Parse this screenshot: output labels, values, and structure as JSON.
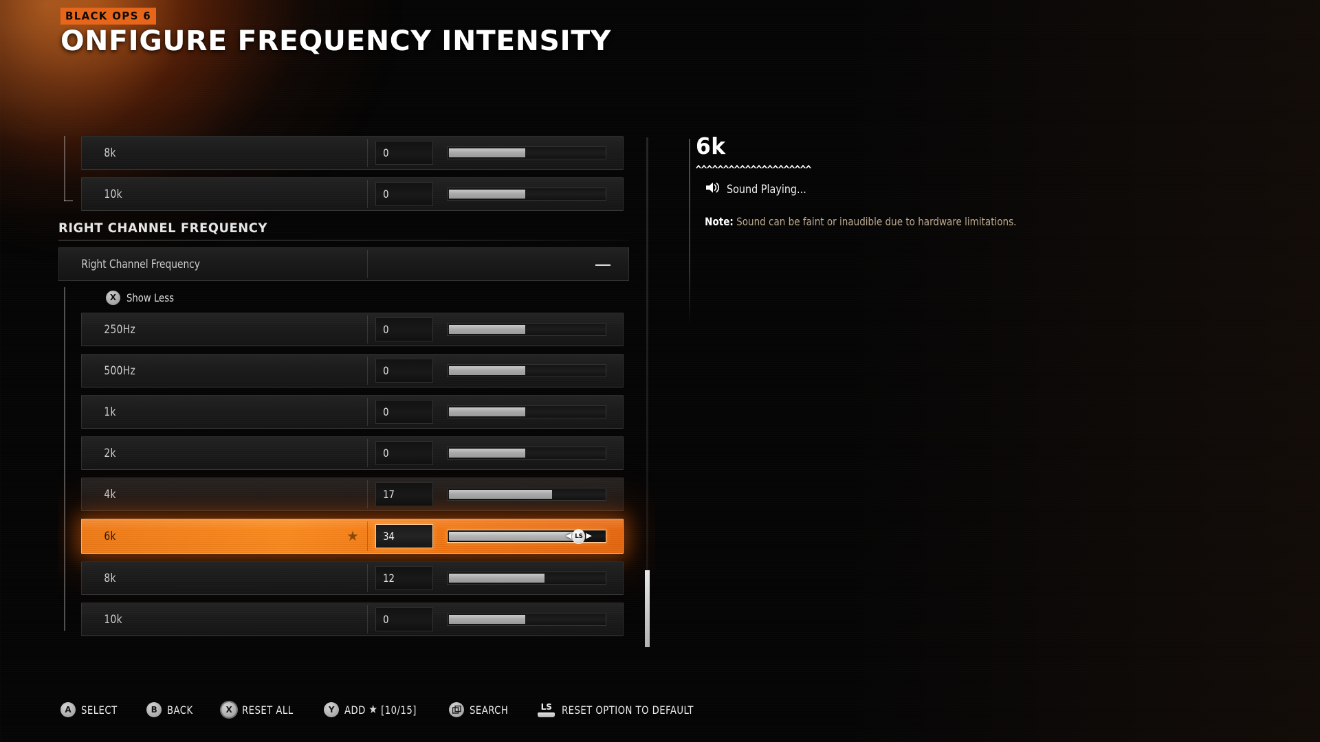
{
  "header": {
    "badge": "BLACK OPS 6",
    "title": "ONFIGURE FREQUENCY INTENSITY"
  },
  "colors": {
    "accent": "#f37712",
    "badge_bg": "#e8661a",
    "row_bg": "#1b1b1b",
    "note_text": "#bda98e",
    "slider_fill": "#a8a8a8"
  },
  "list": {
    "top_rows": [
      {
        "label": "8k",
        "value": "0",
        "fill_pct": 50
      },
      {
        "label": "10k",
        "value": "0",
        "fill_pct": 50
      }
    ],
    "section": {
      "title": "RIGHT CHANNEL FREQUENCY",
      "group_row": {
        "label": "Right Channel Frequency",
        "control": "—"
      },
      "show_less": {
        "button": "X",
        "label": "Show Less"
      },
      "rows": [
        {
          "label": "250Hz",
          "value": "0",
          "fill_pct": 50,
          "selected": false,
          "starred": false
        },
        {
          "label": "500Hz",
          "value": "0",
          "fill_pct": 50,
          "selected": false,
          "starred": false
        },
        {
          "label": "1k",
          "value": "0",
          "fill_pct": 50,
          "selected": false,
          "starred": false
        },
        {
          "label": "2k",
          "value": "0",
          "fill_pct": 50,
          "selected": false,
          "starred": false
        },
        {
          "label": "4k",
          "value": "17",
          "fill_pct": 67,
          "selected": false,
          "starred": false
        },
        {
          "label": "6k",
          "value": "34",
          "fill_pct": 83,
          "selected": true,
          "starred": true
        },
        {
          "label": "8k",
          "value": "12",
          "fill_pct": 62,
          "selected": false,
          "starred": false
        },
        {
          "label": "10k",
          "value": "0",
          "fill_pct": 50,
          "selected": false,
          "starred": false
        }
      ]
    }
  },
  "info": {
    "title": "6k",
    "status": "Sound Playing...",
    "note_key": "Note:",
    "note_value": "Sound can be faint or inaudible due to hardware limitations."
  },
  "footer": {
    "items": [
      {
        "glyph": "A",
        "type": "circle",
        "label": "SELECT",
        "ring": false,
        "star": false,
        "count": ""
      },
      {
        "glyph": "B",
        "type": "circle",
        "label": "BACK",
        "ring": false,
        "star": false,
        "count": ""
      },
      {
        "glyph": "X",
        "type": "circle",
        "label": "RESET ALL",
        "ring": true,
        "star": false,
        "count": ""
      },
      {
        "glyph": "Y",
        "type": "circle",
        "label": "ADD",
        "ring": false,
        "star": true,
        "count": "[10/15]"
      },
      {
        "glyph": "",
        "type": "square",
        "label": "SEARCH",
        "ring": false,
        "star": false,
        "count": ""
      },
      {
        "glyph": "LS",
        "type": "stick",
        "label": "RESET OPTION TO DEFAULT",
        "ring": false,
        "star": false,
        "count": ""
      }
    ]
  }
}
